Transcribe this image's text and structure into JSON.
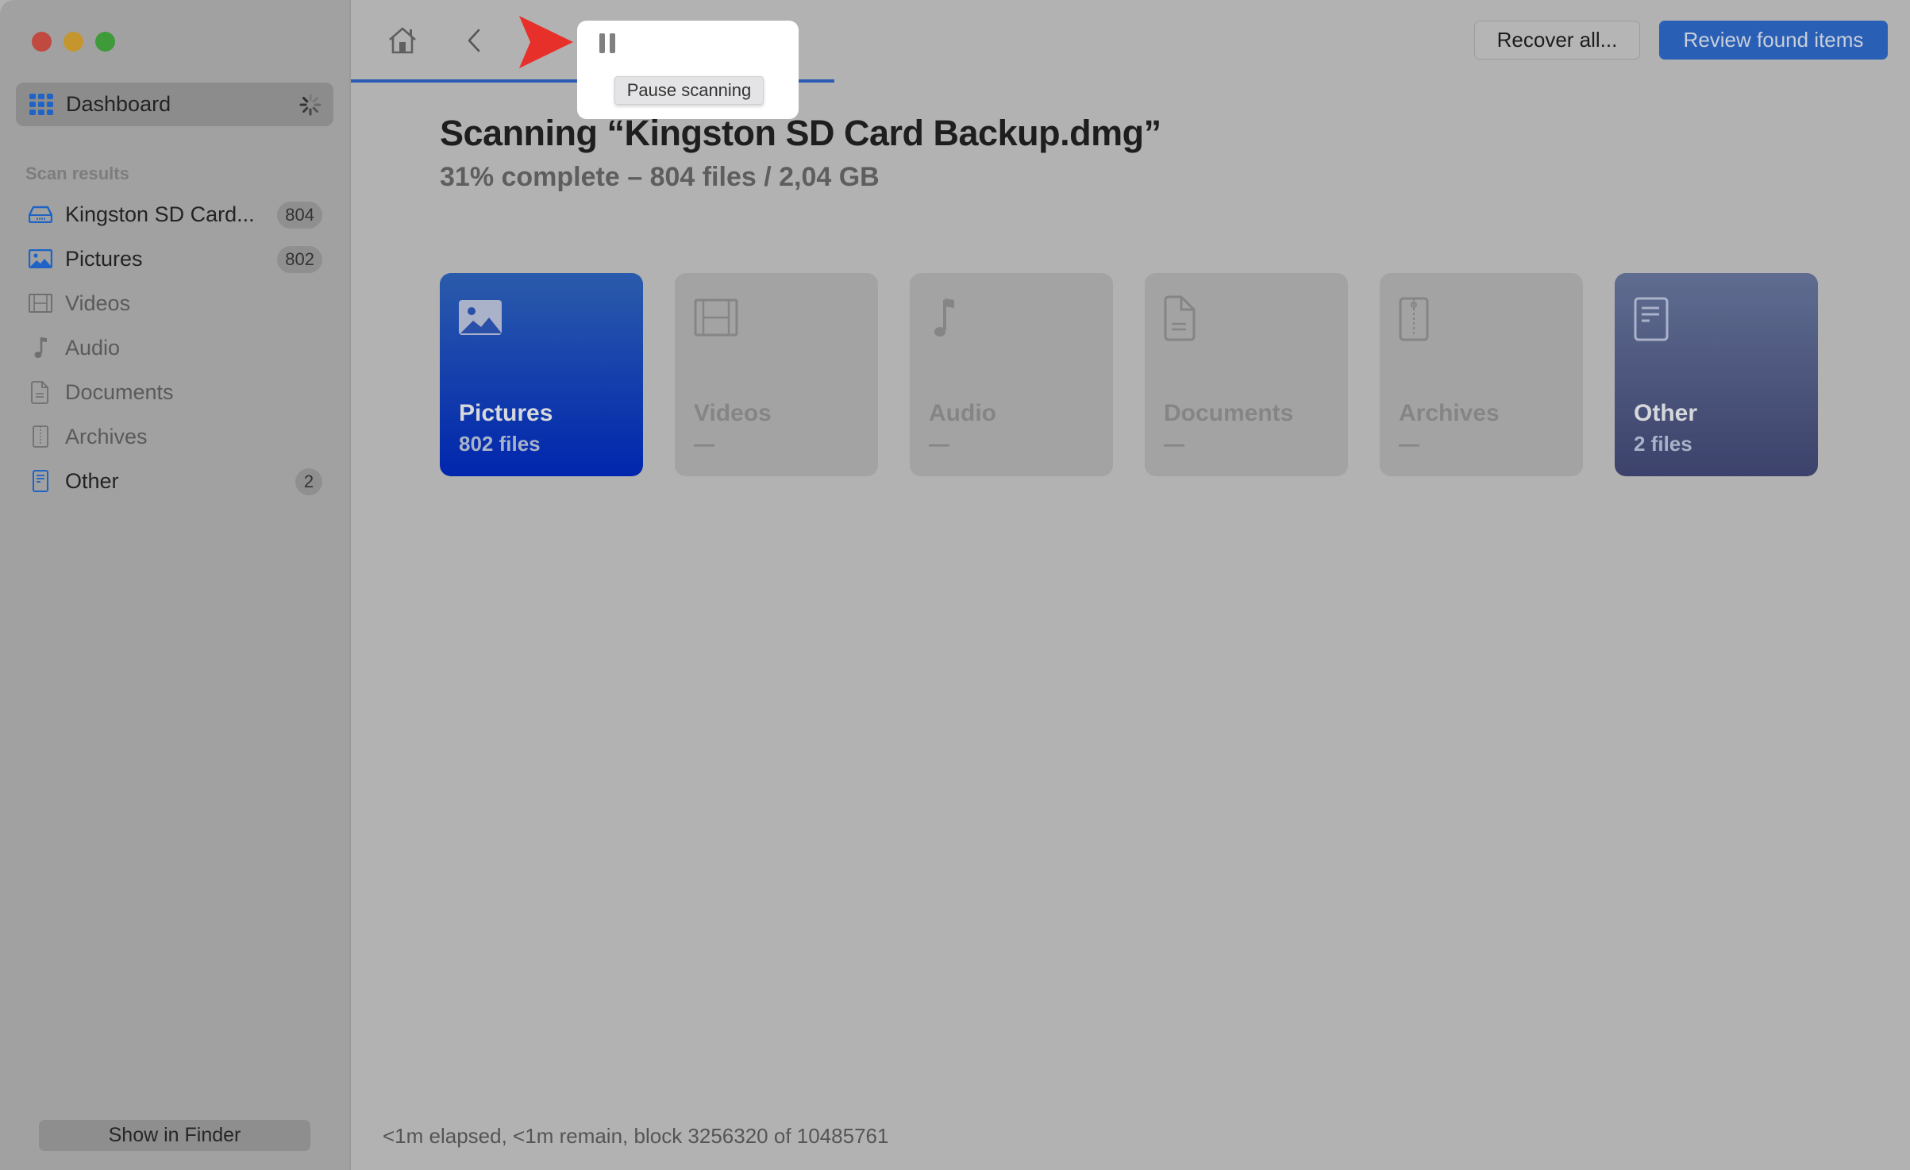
{
  "window": {
    "controls": [
      "close",
      "minimize",
      "zoom"
    ]
  },
  "sidebar": {
    "dashboard": {
      "label": "Dashboard",
      "icon": "grid-icon",
      "busy": true
    },
    "section_label": "Scan results",
    "items": [
      {
        "label": "Kingston SD Card...",
        "icon": "drive-icon",
        "badge": "804",
        "active": true
      },
      {
        "label": "Pictures",
        "icon": "photo-icon",
        "badge": "802",
        "active": true
      },
      {
        "label": "Videos",
        "icon": "film-icon",
        "badge": null,
        "active": false
      },
      {
        "label": "Audio",
        "icon": "music-note-icon",
        "badge": null,
        "active": false
      },
      {
        "label": "Documents",
        "icon": "document-icon",
        "badge": null,
        "active": false
      },
      {
        "label": "Archives",
        "icon": "archive-icon",
        "badge": null,
        "active": false
      },
      {
        "label": "Other",
        "icon": "other-file-icon",
        "badge": "2",
        "active": true
      }
    ],
    "show_in_finder": "Show in Finder"
  },
  "toolbar": {
    "home_icon": "home-icon",
    "back_icon": "chevron-left-icon",
    "pause_icon": "pause-icon",
    "pause_tooltip": "Pause scanning",
    "recover_all": "Recover all...",
    "review_found_items": "Review found items",
    "progress_percent": 31,
    "accent_color": "#2a5bb5"
  },
  "main": {
    "title": "Scanning “Kingston SD Card Backup.dmg”",
    "subtitle": "31% complete – 804 files / 2,04 GB",
    "cards": [
      {
        "name": "Pictures",
        "count": "802 files",
        "icon": "photo-icon"
      },
      {
        "name": "Videos",
        "count": "—",
        "icon": "film-icon"
      },
      {
        "name": "Audio",
        "count": "—",
        "icon": "music-note-icon"
      },
      {
        "name": "Documents",
        "count": "—",
        "icon": "document-icon"
      },
      {
        "name": "Archives",
        "count": "—",
        "icon": "archive-icon"
      },
      {
        "name": "Other",
        "count": "2 files",
        "icon": "other-file-icon"
      }
    ],
    "status": "<1m elapsed, <1m remain, block 3256320 of 10485761"
  }
}
